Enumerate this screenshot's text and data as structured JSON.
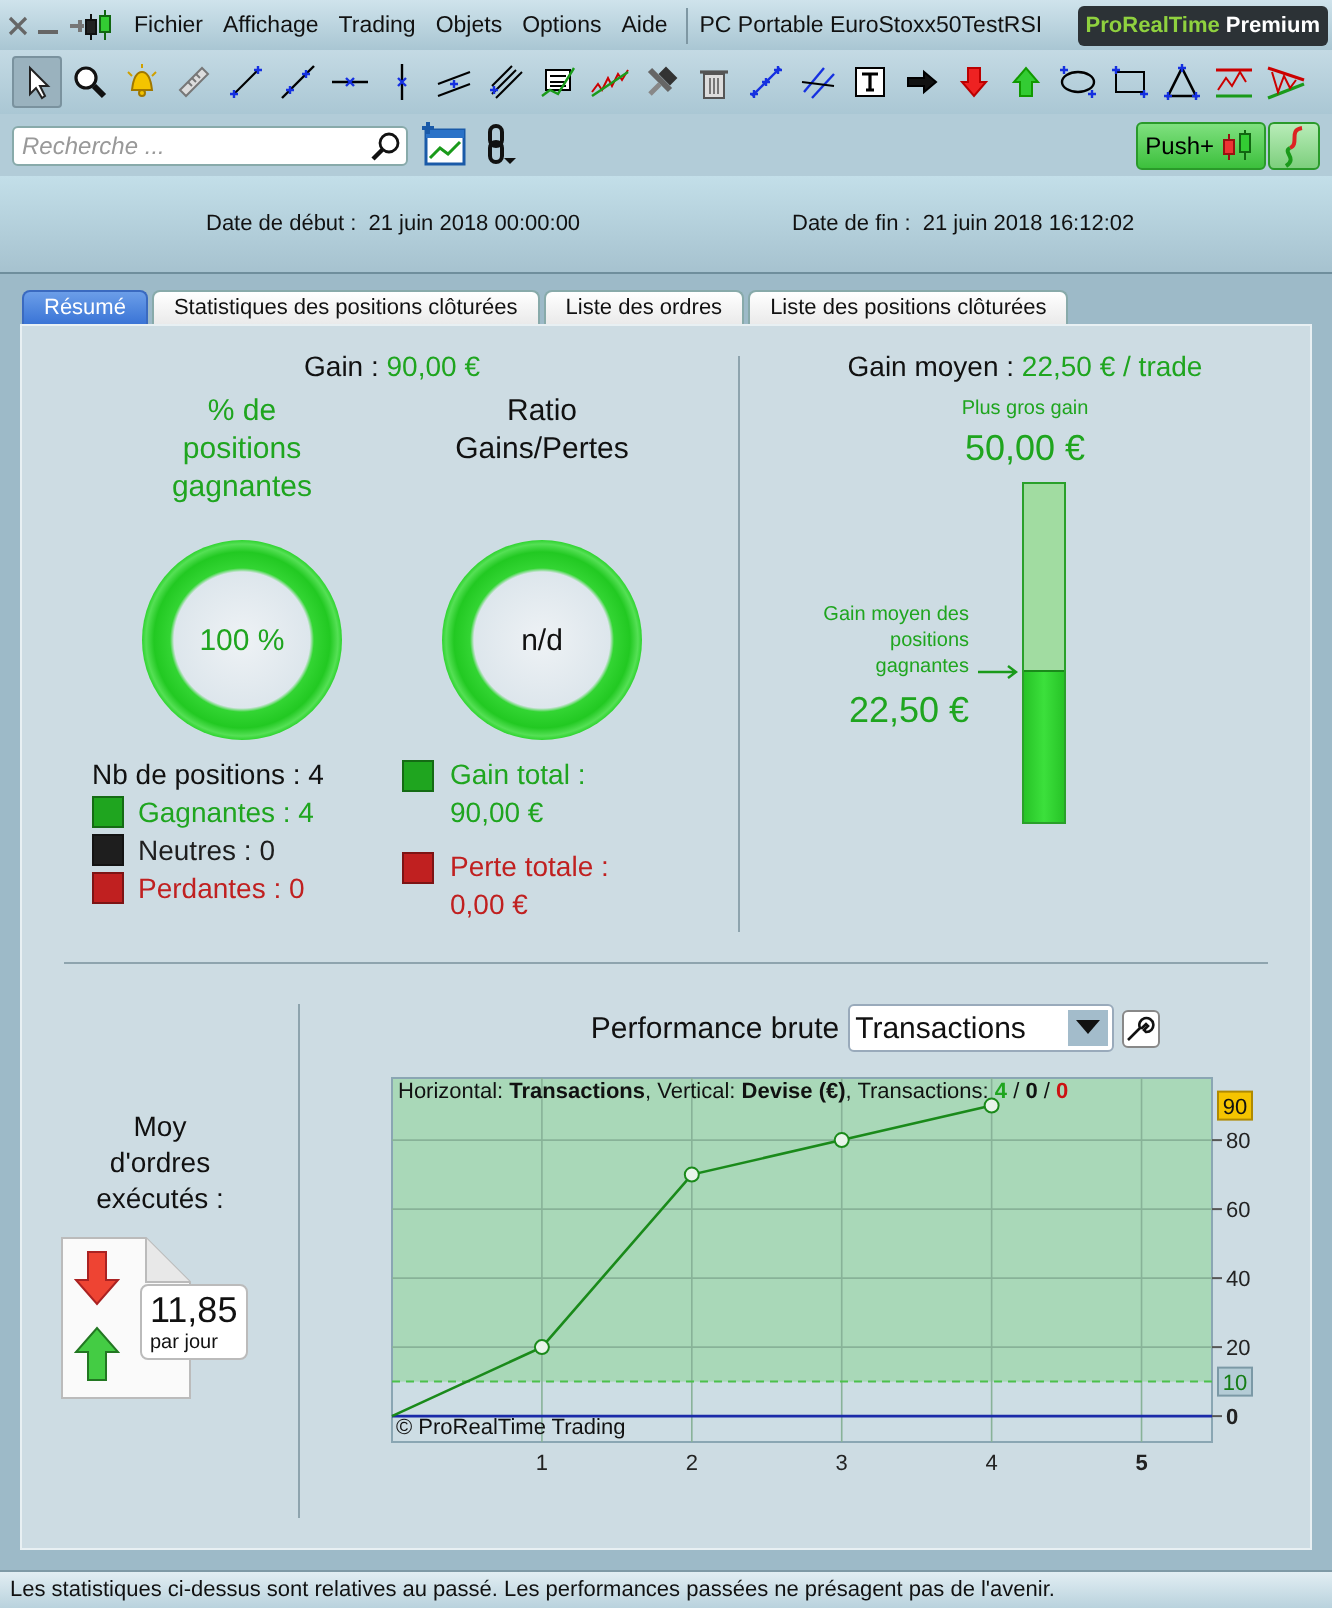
{
  "menu_bar": {
    "items": [
      "Fichier",
      "Affichage",
      "Trading",
      "Objets",
      "Options",
      "Aide"
    ],
    "title": "PC Portable EuroStoxx50TestRSI",
    "brand": "ProRealTime",
    "brand_edition": "Premium"
  },
  "toolbar_tools": [
    {
      "selected": true
    },
    {
      "selected": false
    },
    {
      "selected": false
    },
    {
      "selected": false
    },
    {
      "selected": false
    },
    {
      "selected": false
    },
    {
      "selected": false
    },
    {
      "selected": false
    },
    {
      "selected": false
    },
    {
      "selected": false
    },
    {
      "selected": false
    },
    {
      "selected": false
    },
    {
      "selected": false
    },
    {
      "selected": false
    },
    {
      "selected": false
    },
    {
      "selected": false
    },
    {
      "selected": false
    },
    {
      "selected": false
    },
    {
      "selected": false
    },
    {
      "selected": false
    },
    {
      "selected": false
    },
    {
      "selected": false
    },
    {
      "selected": false
    },
    {
      "selected": false
    },
    {
      "selected": false
    }
  ],
  "search": {
    "placeholder": "Recherche ..."
  },
  "push_button": "Push+",
  "header": {
    "start_label": "Date de début :",
    "start_value": "21 juin 2018 00:00:00",
    "end_label": "Date de fin :",
    "end_value": "21 juin 2018 16:12:02"
  },
  "tabs": [
    {
      "label": "Résumé",
      "selected": true
    },
    {
      "label": "Statistiques des positions clôturées",
      "selected": false
    },
    {
      "label": "Liste des ordres",
      "selected": false
    },
    {
      "label": "Liste des positions clôturées",
      "selected": false
    }
  ],
  "summary": {
    "gain_label": "Gain :",
    "gain_value": "90,00 €",
    "win_rate": {
      "title": "% de positions gagnantes",
      "value": "100 %"
    },
    "ratio": {
      "title": "Ratio Gains/Pertes",
      "value": "n/d"
    },
    "positions_count": "Nb de positions : 4",
    "position_legend": [
      {
        "text": "Gagnantes : 4",
        "color": "#1fa51f"
      },
      {
        "text": "Neutres : 0",
        "color": "#1e1e1e"
      },
      {
        "text": "Perdantes : 0",
        "color": "#c02020"
      }
    ],
    "totals": [
      {
        "label": "Gain total :",
        "value": "90,00 €",
        "color": "#1fa51f"
      },
      {
        "label": "Perte totale :",
        "value": "0,00 €",
        "color": "#c02020"
      }
    ]
  },
  "average_gain": {
    "label": "Gain moyen :",
    "value": "22,50 € / trade",
    "max_label": "Plus gros gain",
    "max_value": "50,00 €",
    "marker_label": "Gain moyen des positions gagnantes",
    "marker_value": "22,50 €",
    "level": 0.45
  },
  "orders": {
    "title": "Moy d'ordres exécutés :",
    "value": "11,85",
    "unit": "par jour"
  },
  "performance": {
    "label": "Performance brute",
    "select_value": "Transactions",
    "caption": "Horizontal: **Transactions**, Vertical: **Devise (€)**, Transactions:",
    "counts": [
      {
        "text": "4",
        "color": "#1fa51f"
      },
      {
        "text": "0",
        "color": "#111111"
      },
      {
        "text": "0",
        "color": "#cc1111"
      }
    ],
    "count_separator": "/",
    "copyright": "© ProRealTime Trading",
    "chart_data": {
      "type": "line",
      "x": [
        0,
        1,
        2,
        3,
        4
      ],
      "series": [
        {
          "color": "#1a8a1a",
          "marker": "o",
          "values": [
            0,
            20,
            70,
            80,
            90
          ]
        }
      ],
      "xlim": [
        0,
        5.47
      ],
      "ylim": [
        -7.5,
        98
      ],
      "xticks": [
        1,
        2,
        3,
        4,
        5
      ],
      "yticks": [
        0,
        20,
        40,
        60,
        80
      ],
      "grid": true,
      "ref_lines": [
        {
          "axis": "y",
          "value": 0,
          "color": "#1a2aa8"
        },
        {
          "axis": "y",
          "value": 10,
          "label": "10",
          "color": "#4cc04c"
        }
      ],
      "bands": [
        {
          "axis": "y",
          "from": 10,
          "to": 98,
          "color": "#a9d8b8"
        }
      ],
      "annotations": [
        "90"
      ]
    }
  },
  "status_bar": "Les statistiques ci-dessus sont relatives au passé. Les performances passées ne présagent pas de l'avenir."
}
